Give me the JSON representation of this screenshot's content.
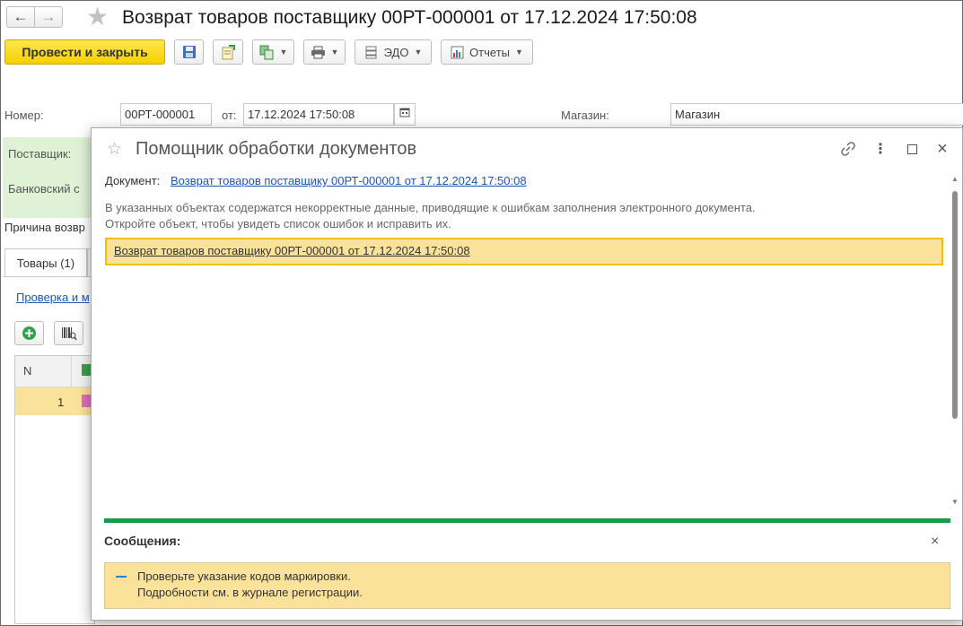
{
  "window": {
    "title": "Возврат товаров поставщику 00РТ-000001 от 17.12.2024 17:50:08"
  },
  "toolbar": {
    "post_close_label": "Провести и закрыть",
    "edo_label": "ЭДО",
    "reports_label": "Отчеты"
  },
  "form": {
    "number_label": "Номер:",
    "number_value": "00РТ-000001",
    "from_label": "от:",
    "date_value": "17.12.2024 17:50:08",
    "store_label": "Магазин:",
    "store_value": "Магазин",
    "supplier_label": "Поставщик:",
    "bank_label": "Банковский с",
    "reason_label": "Причина возвр",
    "tab_goods": "Товары (1)",
    "check_link": "Проверка и м",
    "grid_col_n": "N",
    "grid_row_n": "1"
  },
  "dialog": {
    "title": "Помощник обработки документов",
    "document_label": "Документ:",
    "document_link": "Возврат товаров поставщику 00РТ-000001 от 17.12.2024 17:50:08",
    "info_line1": "В указанных объектах содержатся некорректные данные, приводящие к ошибкам заполнения электронного документа.",
    "info_line2": "Откройте объект, чтобы увидеть список ошибок и исправить их.",
    "item": "Возврат товаров поставщику 00РТ-000001 от 17.12.2024 17:50:08",
    "messages_title": "Сообщения:",
    "message_line1": "Проверьте указание кодов маркировки.",
    "message_line2": "Подробности см. в журнале регистрации."
  },
  "colors": {
    "primary_button": "#f5d000",
    "link": "#1a56b8",
    "highlight_row": "#fbe29b",
    "separator_green": "#179d4a"
  }
}
